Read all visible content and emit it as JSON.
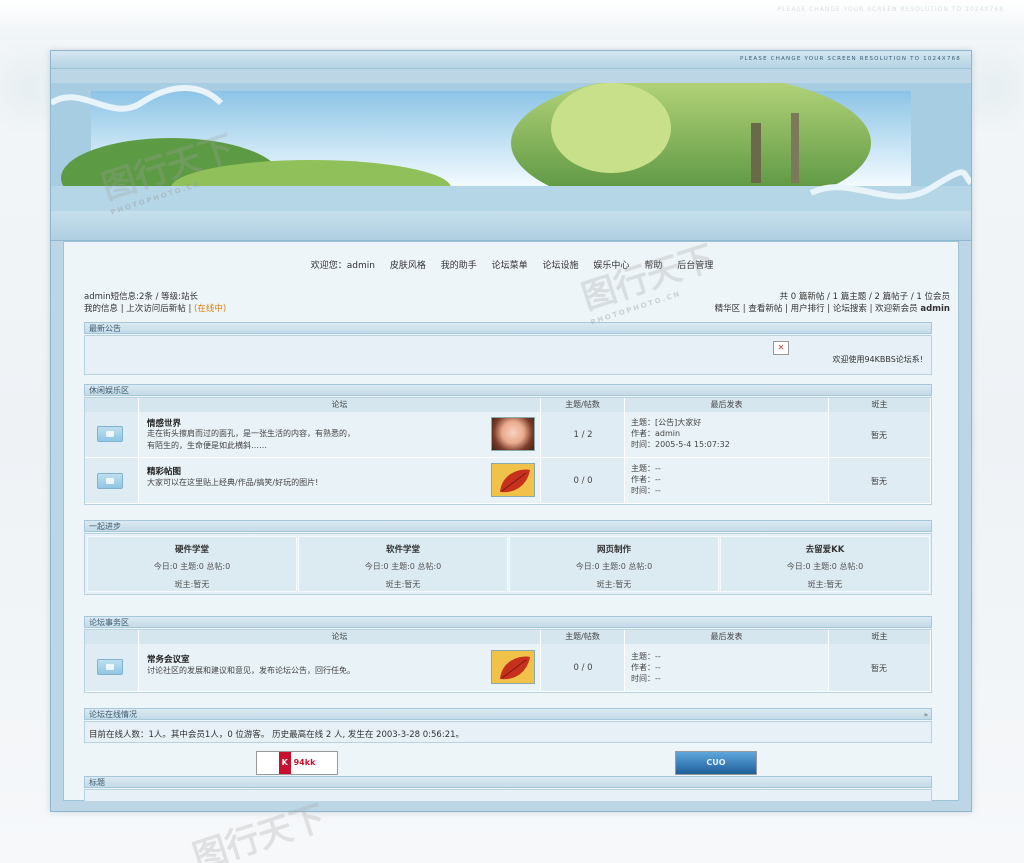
{
  "header": {
    "resolution_note": "PLEASE CHANGE YOUR SCREEN RESOLUTION TO 1024X768"
  },
  "nav": {
    "items": [
      "欢迎您：admin",
      "皮肤风格",
      "我的助手",
      "论坛菜单",
      "论坛设施",
      "娱乐中心",
      "帮助",
      "后台管理"
    ]
  },
  "user": {
    "line1": "admin短信息:2条 / 等级:站长",
    "line2_prefix": "我的信息 | 上次访问后新帖 | ",
    "line2_status": "(在线中)"
  },
  "stats": {
    "line1": "共 0 篇新帖 / 1 篇主题 / 2 篇帖子 / 1 位会员",
    "line2_prefix": "精华区 | 查看新帖 | 用户排行 | 论坛搜索 | 欢迎新会员 ",
    "newest_member": "admin"
  },
  "announcements": {
    "title": "最新公告",
    "text": "欢迎使用94KBBS论坛系!"
  },
  "leisure": {
    "title": "休闲娱乐区",
    "col_forum": "论坛",
    "col_counts": "主题/帖数",
    "col_last": "最后发表",
    "col_mod": "斑主",
    "forums": [
      {
        "name": "情感世界",
        "desc1": "走在街头擦肩而过的面孔，是一张生活的内容，有熟悉的，",
        "desc2": "有陌生的，生命便是如此横斜……",
        "counts": "1 / 2",
        "last_topic": "主题：[公告]大家好",
        "last_author": "作者：admin",
        "last_time": "时间：2005-5-4 15:07:32",
        "moderator": "暂无"
      },
      {
        "name": "精彩帖图",
        "desc1": "大家可以在这里贴上经典/作品/搞笑/好玩的图片!",
        "desc2": "",
        "counts": "0 / 0",
        "last_topic": "主题：--",
        "last_author": "作者：--",
        "last_time": "时间：--",
        "moderator": "暂无"
      }
    ]
  },
  "learning": {
    "title": "一起进步",
    "cells": [
      {
        "name": "硬件学堂",
        "stats": "今日:0 主题:0 总帖:0",
        "mod": "斑主:暂无"
      },
      {
        "name": "软件学堂",
        "stats": "今日:0 主题:0 总帖:0",
        "mod": "斑主:暂无"
      },
      {
        "name": "网页制作",
        "stats": "今日:0 主题:0 总帖:0",
        "mod": "斑主:暂无"
      },
      {
        "name": "去留爱KK",
        "stats": "今日:0 主题:0 总帖:0",
        "mod": "斑主:暂无"
      }
    ]
  },
  "affairs": {
    "title": "论坛事务区",
    "col_forum": "论坛",
    "col_counts": "主题/帖数",
    "col_last": "最后发表",
    "col_mod": "斑主",
    "forum": {
      "name": "常务会议室",
      "desc": "讨论社区的发展和建议和意见，发布论坛公告，回行任免。",
      "counts": "0 / 0",
      "last_topic": "主题：--",
      "last_author": "作者：--",
      "last_time": "时间：--",
      "moderator": "暂无"
    }
  },
  "online": {
    "title": "论坛在线情况",
    "text": "目前在线人数：1人。其中会员1人，0 位游客。 历史最高在线 2 人, 发生在 2003-3-28 0:56:21。"
  },
  "links": {
    "title": "标题",
    "logo1": "94kk",
    "logo2": "CUO"
  },
  "watermark": {
    "text": "图行天下",
    "sub": "PHOTOPHOTO.CN"
  }
}
